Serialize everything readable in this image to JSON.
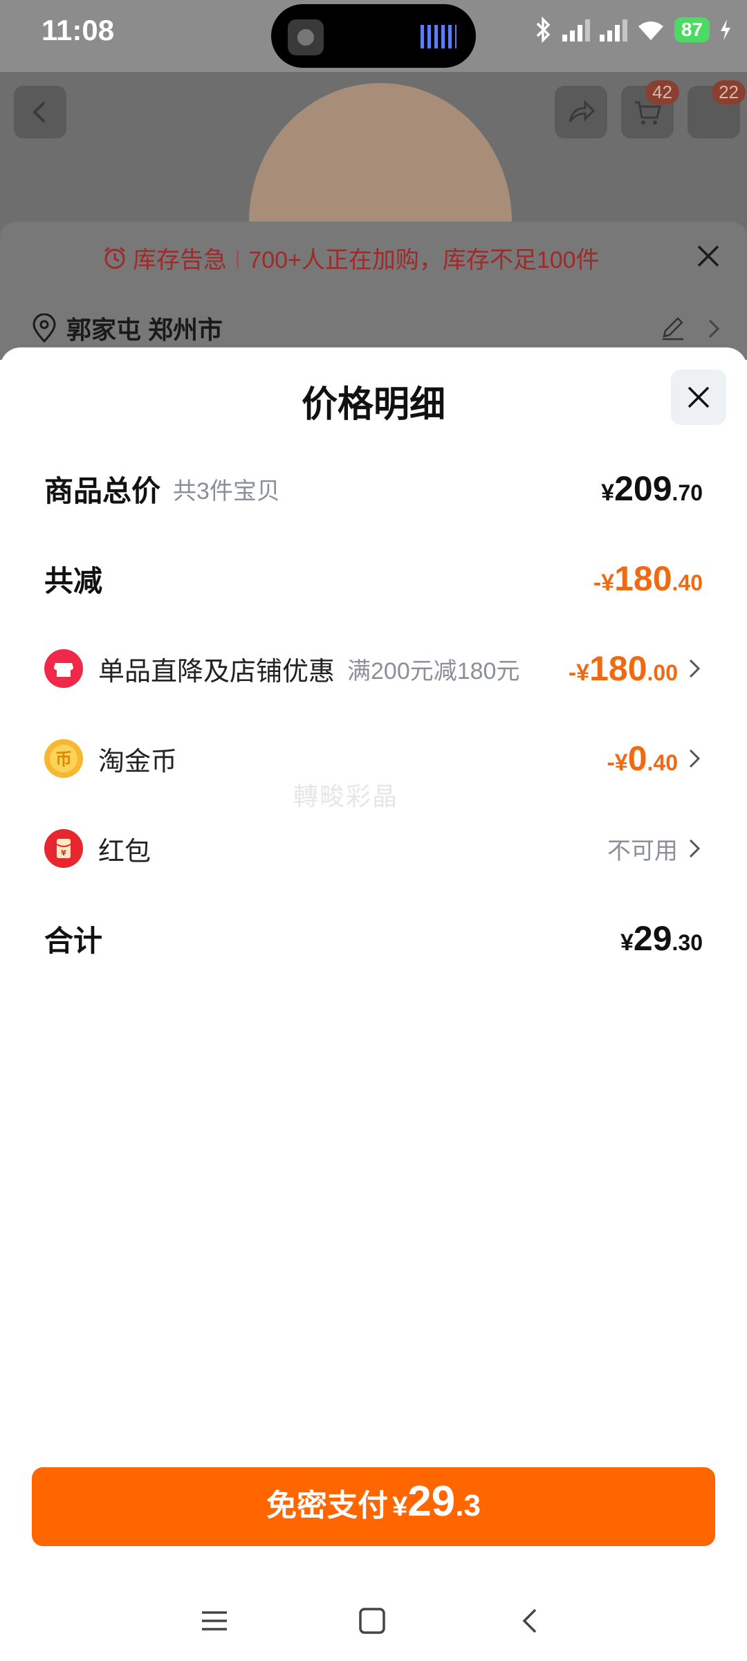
{
  "status_bar": {
    "time": "11:08",
    "battery": "87"
  },
  "background": {
    "cart_badge": "42",
    "more_badge": "22",
    "alert_title": "库存告急",
    "alert_text": "700+人正在加购，库存不足100件",
    "address": "郭家屯 郑州市"
  },
  "sheet": {
    "title": "价格明细",
    "total": {
      "label": "商品总价",
      "sub": "共3件宝贝",
      "yen": "¥",
      "int": "209",
      "dec": ".70"
    },
    "reduce": {
      "label": "共减",
      "prefix": "-¥",
      "int": "180",
      "dec": ".40"
    },
    "items": [
      {
        "label": "单品直降及店铺优惠",
        "sub": "满200元减180元",
        "prefix": "-¥",
        "int": "180",
        "dec": ".00",
        "icon": "store-icon"
      },
      {
        "label": "淘金币",
        "prefix": "-¥",
        "int": "0",
        "dec": ".40",
        "icon": "coin-icon"
      },
      {
        "label": "红包",
        "status": "不可用",
        "icon": "red-packet-icon"
      }
    ],
    "sum": {
      "label": "合计",
      "yen": "¥",
      "int": "29",
      "dec": ".30"
    },
    "watermark": "轉畯彩晶"
  },
  "pay_button": {
    "label": "免密支付",
    "yen": "¥",
    "int": "29",
    "dec": ".3"
  },
  "colors": {
    "accent": "#ff6600",
    "discount": "#f06a14",
    "alert": "#9e2a2a"
  }
}
